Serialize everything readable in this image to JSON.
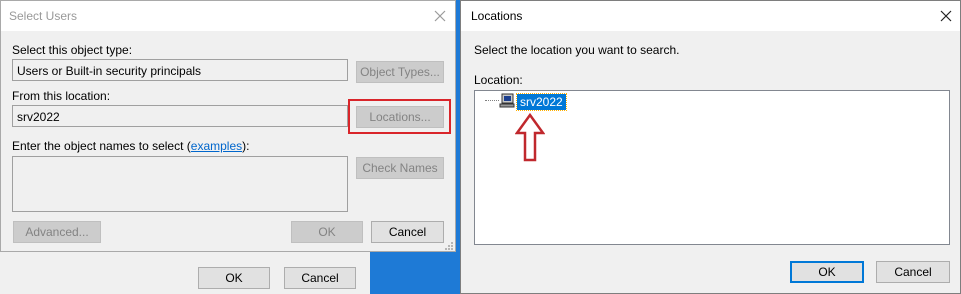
{
  "select_users": {
    "title": "Select Users",
    "object_type_label": "Select this object type:",
    "object_type_value": "Users or Built-in security principals",
    "object_types_button": "Object Types...",
    "location_label": "From this location:",
    "location_value": "srv2022",
    "locations_button": "Locations...",
    "names_label_prefix": "Enter the object names to select (",
    "names_label_link": "examples",
    "names_label_suffix": "):",
    "names_value": "",
    "check_names_button": "Check Names",
    "advanced_button": "Advanced...",
    "ok_button": "OK",
    "cancel_button": "Cancel"
  },
  "background_dialog": {
    "ok_button": "OK",
    "cancel_button": "Cancel"
  },
  "locations": {
    "title": "Locations",
    "instruction": "Select the location you want to search.",
    "location_label": "Location:",
    "tree_items": [
      {
        "label": "srv2022",
        "selected": true
      }
    ],
    "ok_button": "OK",
    "cancel_button": "Cancel"
  },
  "annotations": {
    "highlight_color": "#d9252a",
    "arrow_color": "#c0282d"
  }
}
